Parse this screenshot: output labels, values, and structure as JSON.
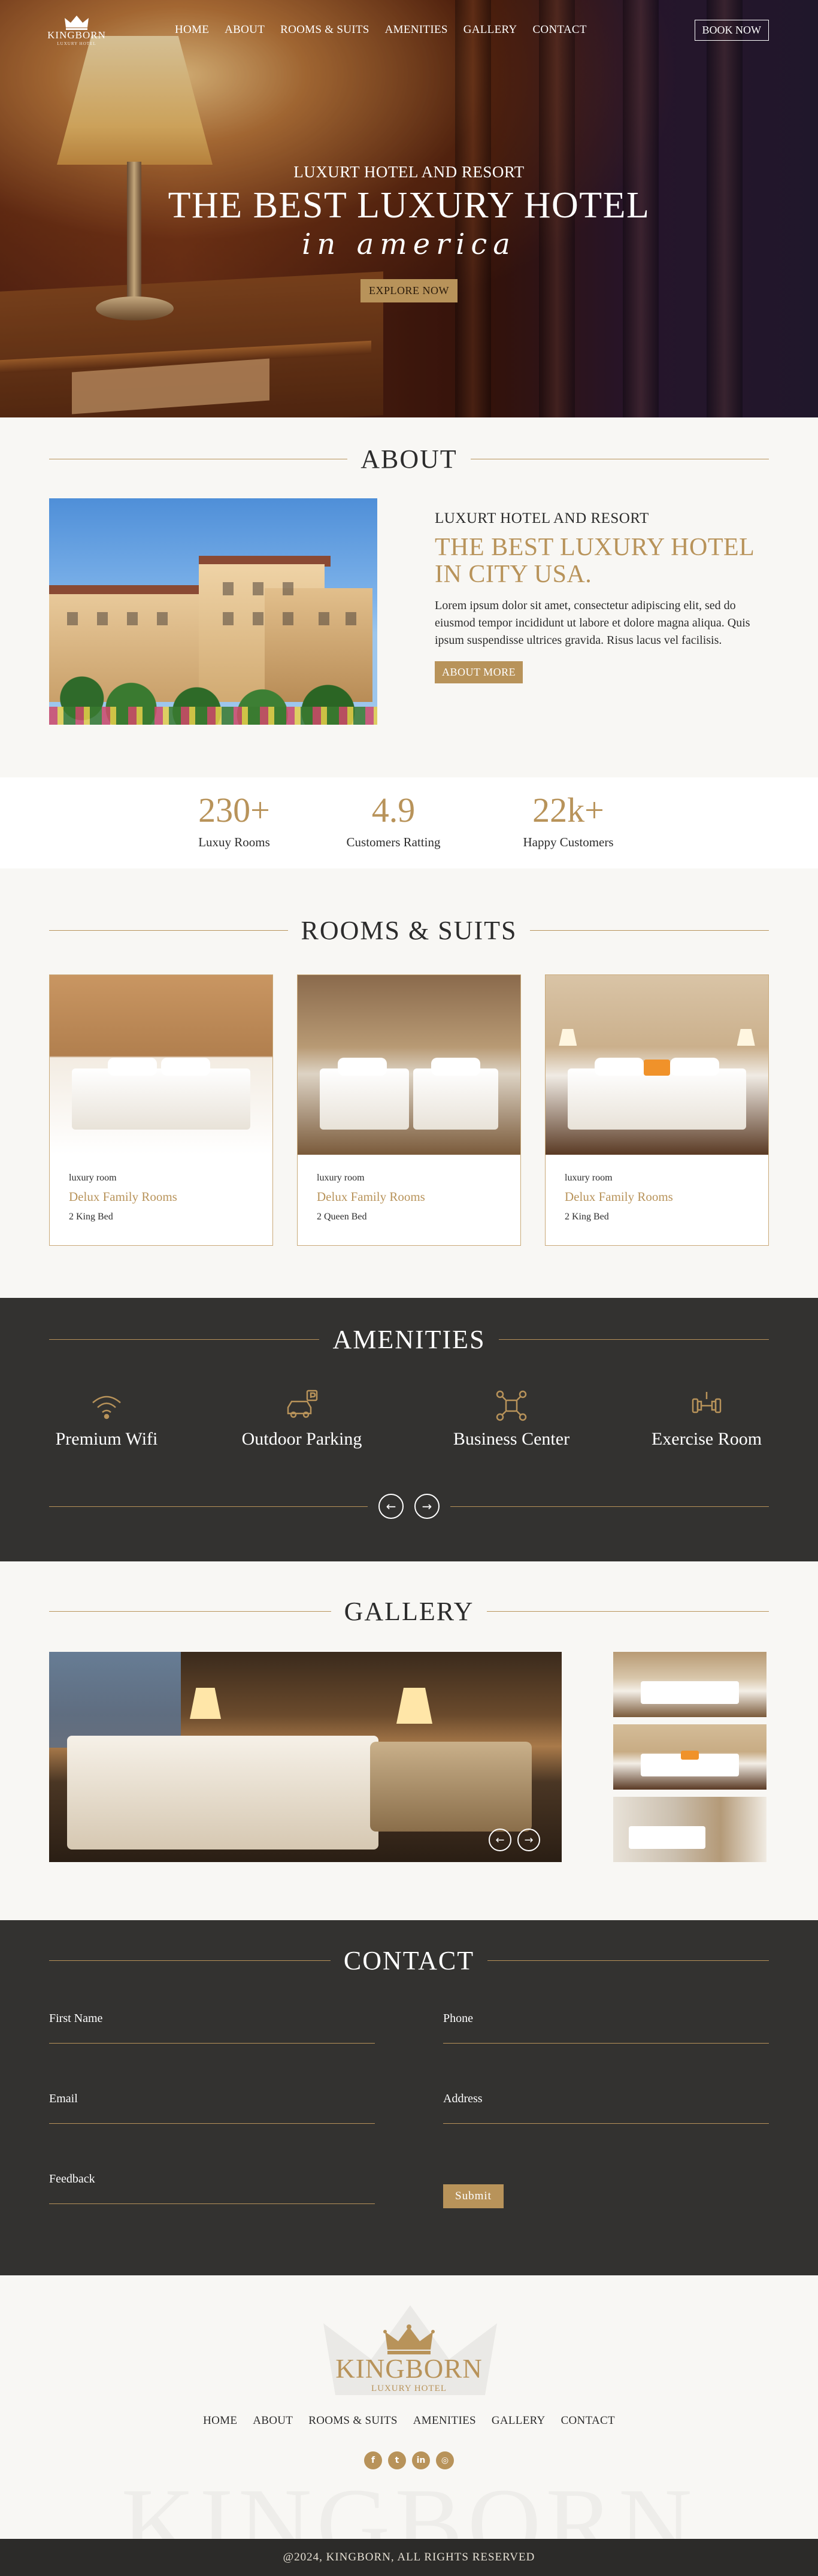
{
  "brand": {
    "name": "KINGBORN",
    "sub": "LUXURY HOTEL"
  },
  "nav": {
    "items": [
      "HOME",
      "ABOUT",
      "ROOMS & SUITS",
      "AMENITIES",
      "GALLERY",
      "CONTACT"
    ],
    "book_label": "BOOK NOW"
  },
  "hero": {
    "kicker": "LUXURT HOTEL AND RESORT",
    "title": "THE BEST LUXURY HOTEL",
    "script": "in america",
    "button": "EXPLORE NOW"
  },
  "about": {
    "heading": "ABOUT",
    "kicker": "LUXURT HOTEL AND RESORT",
    "title": "THE BEST LUXURY HOTEL IN CITY USA.",
    "text": "Lorem ipsum dolor sit amet, consectetur adipiscing elit, sed do eiusmod tempor incididunt ut labore et dolore magna aliqua. Quis ipsum suspendisse ultrices gravida. Risus lacus vel facilisis.",
    "button": "ABOUT MORE"
  },
  "stats": [
    {
      "value": "230+",
      "label": "Luxuy Rooms"
    },
    {
      "value": "4.9",
      "label": "Customers Ratting"
    },
    {
      "value": "22k+",
      "label": "Happy Customers"
    }
  ],
  "rooms": {
    "heading": "ROOMS & SUITS",
    "cards": [
      {
        "type": "luxury room",
        "name": "Delux Family Rooms",
        "bed": "2 King Bed"
      },
      {
        "type": "luxury room",
        "name": "Delux Family Rooms",
        "bed": "2 Queen Bed"
      },
      {
        "type": "luxury room",
        "name": "Delux Family Rooms",
        "bed": "2 King Bed"
      }
    ]
  },
  "amenities": {
    "heading": "AMENITIES",
    "items": [
      {
        "label": "Premium Wifi",
        "icon": "wifi-icon"
      },
      {
        "label": "Outdoor Parking",
        "icon": "parking-icon"
      },
      {
        "label": "Business Center",
        "icon": "business-icon"
      },
      {
        "label": "Exercise Room",
        "icon": "dumbbell-icon"
      }
    ]
  },
  "gallery": {
    "heading": "GALLERY"
  },
  "contact": {
    "heading": "CONTACT",
    "fields": {
      "first_name": "First Name",
      "phone": "Phone",
      "email": "Email",
      "address": "Address",
      "feedback": "Feedback"
    },
    "submit": "Submit"
  },
  "footer": {
    "name": "KINGBORN",
    "sub": "LUXURY HOTEL",
    "watermark": "KINGBORN",
    "social": [
      {
        "icon": "facebook-icon",
        "glyph": "f"
      },
      {
        "icon": "twitter-icon",
        "glyph": "t"
      },
      {
        "icon": "linkedin-icon",
        "glyph": "in"
      },
      {
        "icon": "instagram-icon",
        "glyph": "◎"
      }
    ],
    "copyright": "@2024, KINGBORN, ALL RIGHTS RESERVED"
  },
  "colors": {
    "accent": "#b8935a",
    "dark": "#333230",
    "light": "#f8f7f4"
  }
}
